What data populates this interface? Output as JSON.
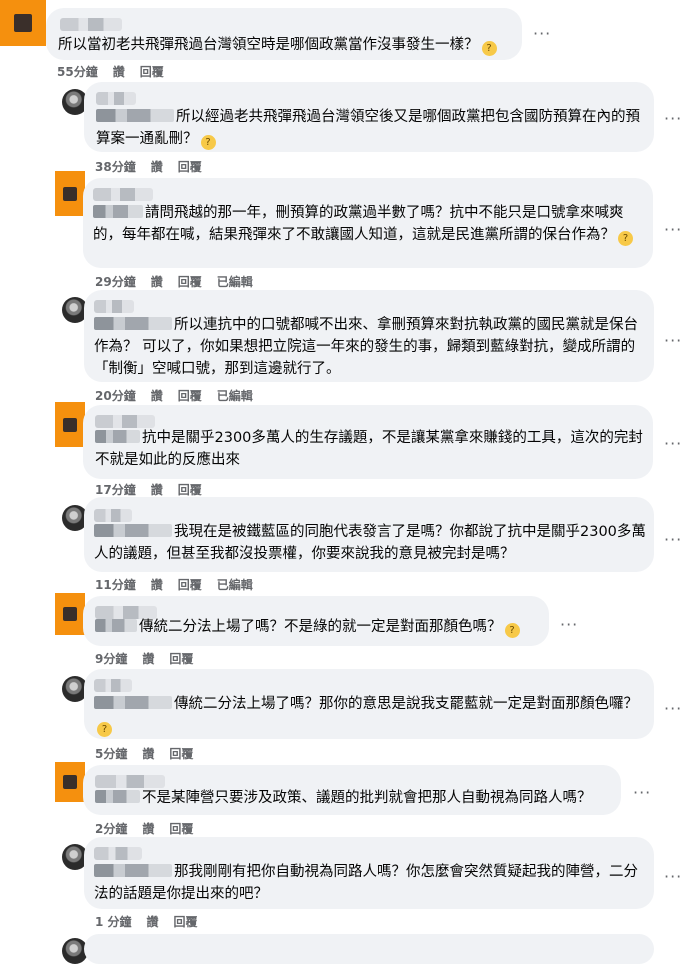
{
  "comments": [
    {
      "text": "所以當初老共飛彈飛過台灣領空時是哪個政黨當作沒事發生一樣？",
      "emoji": true,
      "time": "55分鐘",
      "like": "讚",
      "reply": "回覆",
      "edited": ""
    },
    {
      "text": "所以經過老共飛彈飛過台灣領空後又是哪個政黨把包含國防預算在內的預算案一通亂刪？",
      "emoji": true,
      "time": "38分鐘",
      "like": "讚",
      "reply": "回覆",
      "edited": ""
    },
    {
      "text": "請問飛越的那一年，刪預算的政黨過半數了嗎？抗中不能只是口號拿來喊爽的，每年都在喊，結果飛彈來了不敢讓國人知道，這就是民進黨所謂的保台作為？",
      "emoji": true,
      "time": "29分鐘",
      "like": "讚",
      "reply": "回覆",
      "edited": "已編輯"
    },
    {
      "text": "所以連抗中的口號都喊不出來、拿刪預算來對抗執政黨的國民黨就是保台作為？ 可以了，你如果想把立院這一年來的發生的事，歸類到藍綠對抗，變成所謂的「制衡」空喊口號，那到這邊就行了。",
      "emoji": false,
      "time": "20分鐘",
      "like": "讚",
      "reply": "回覆",
      "edited": "已編輯"
    },
    {
      "text": "抗中是關乎2300多萬人的生存議題，不是讓某黨拿來賺錢的工具，這次的完封不就是如此的反應出來",
      "emoji": false,
      "time": "17分鐘",
      "like": "讚",
      "reply": "回覆",
      "edited": ""
    },
    {
      "text": "我現在是被鐵藍區的同胞代表發言了是嗎？你都說了抗中是關乎2300多萬人的議題，但甚至我都沒投票權，你要來說我的意見被完封是嗎？",
      "emoji": false,
      "time": "11分鐘",
      "like": "讚",
      "reply": "回覆",
      "edited": "已編輯"
    },
    {
      "text": "傳統二分法上場了嗎？不是綠的就一定是對面那顏色嗎？",
      "emoji": true,
      "time": "9分鐘",
      "like": "讚",
      "reply": "回覆",
      "edited": ""
    },
    {
      "text": "傳統二分法上場了嗎？那你的意思是說我支罷藍就一定是對面那顏色囉？",
      "emoji": true,
      "time": "5分鐘",
      "like": "讚",
      "reply": "回覆",
      "edited": ""
    },
    {
      "text": "不是某陣營只要涉及政策、議題的批判就會把那人自動視為同路人嗎？",
      "emoji": false,
      "time": "2分鐘",
      "like": "讚",
      "reply": "回覆",
      "edited": ""
    },
    {
      "text": "那我剛剛有把你自動視為同路人嗎？你怎麼會突然質疑起我的陣營，二分法的話題是你提出來的吧？",
      "emoji": false,
      "time": "1 分鐘",
      "like": "讚",
      "reply": "回覆",
      "edited": ""
    }
  ],
  "more_icon": "more-options-icon",
  "emoji_icon": "thinking-face-icon",
  "colors": {
    "orange_avatar": "#f5900e",
    "bubble": "#f0f2f5",
    "meta": "#65676b"
  }
}
